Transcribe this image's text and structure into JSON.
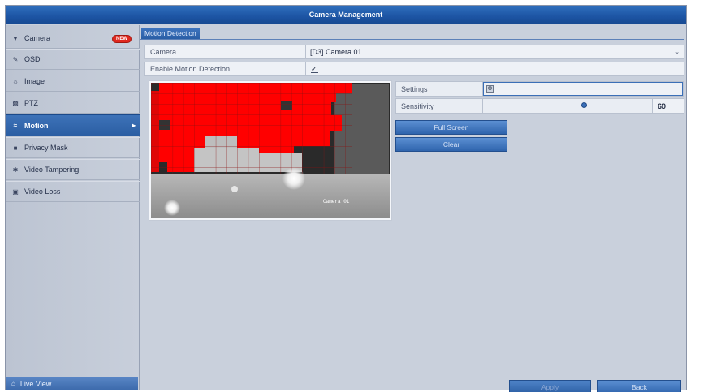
{
  "window": {
    "title": "Camera Management"
  },
  "sidebar": {
    "items": [
      {
        "label": "Camera",
        "icon": "camera-icon",
        "badge": "NEW"
      },
      {
        "label": "OSD",
        "icon": "osd-icon"
      },
      {
        "label": "Image",
        "icon": "image-icon"
      },
      {
        "label": "PTZ",
        "icon": "ptz-icon"
      },
      {
        "label": "Motion",
        "icon": "motion-icon"
      },
      {
        "label": "Privacy Mask",
        "icon": "privacy-mask-icon"
      },
      {
        "label": "Video Tampering",
        "icon": "video-tampering-icon"
      },
      {
        "label": "Video Loss",
        "icon": "video-loss-icon"
      }
    ],
    "active": "Motion",
    "live_view": "Live View"
  },
  "tab": {
    "label": "Motion Detection"
  },
  "form": {
    "camera_label": "Camera",
    "camera_value": "[D3] Camera 01",
    "enable_label": "Enable Motion Detection",
    "enable_checked": true
  },
  "preview": {
    "overlay_text": "Camera 01",
    "highlight_color": "#ff0000"
  },
  "settings": {
    "settings_label": "Settings",
    "sensitivity_label": "Sensitivity",
    "sensitivity_value": "60",
    "sensitivity_level": 0.6
  },
  "buttons": {
    "full_screen": "Full Screen",
    "clear": "Clear",
    "apply": "Apply",
    "back": "Back"
  },
  "colors": {
    "title_bar": "#1d55a4",
    "active_item": "#2b5ea3",
    "motion_area": "#ff0000"
  }
}
